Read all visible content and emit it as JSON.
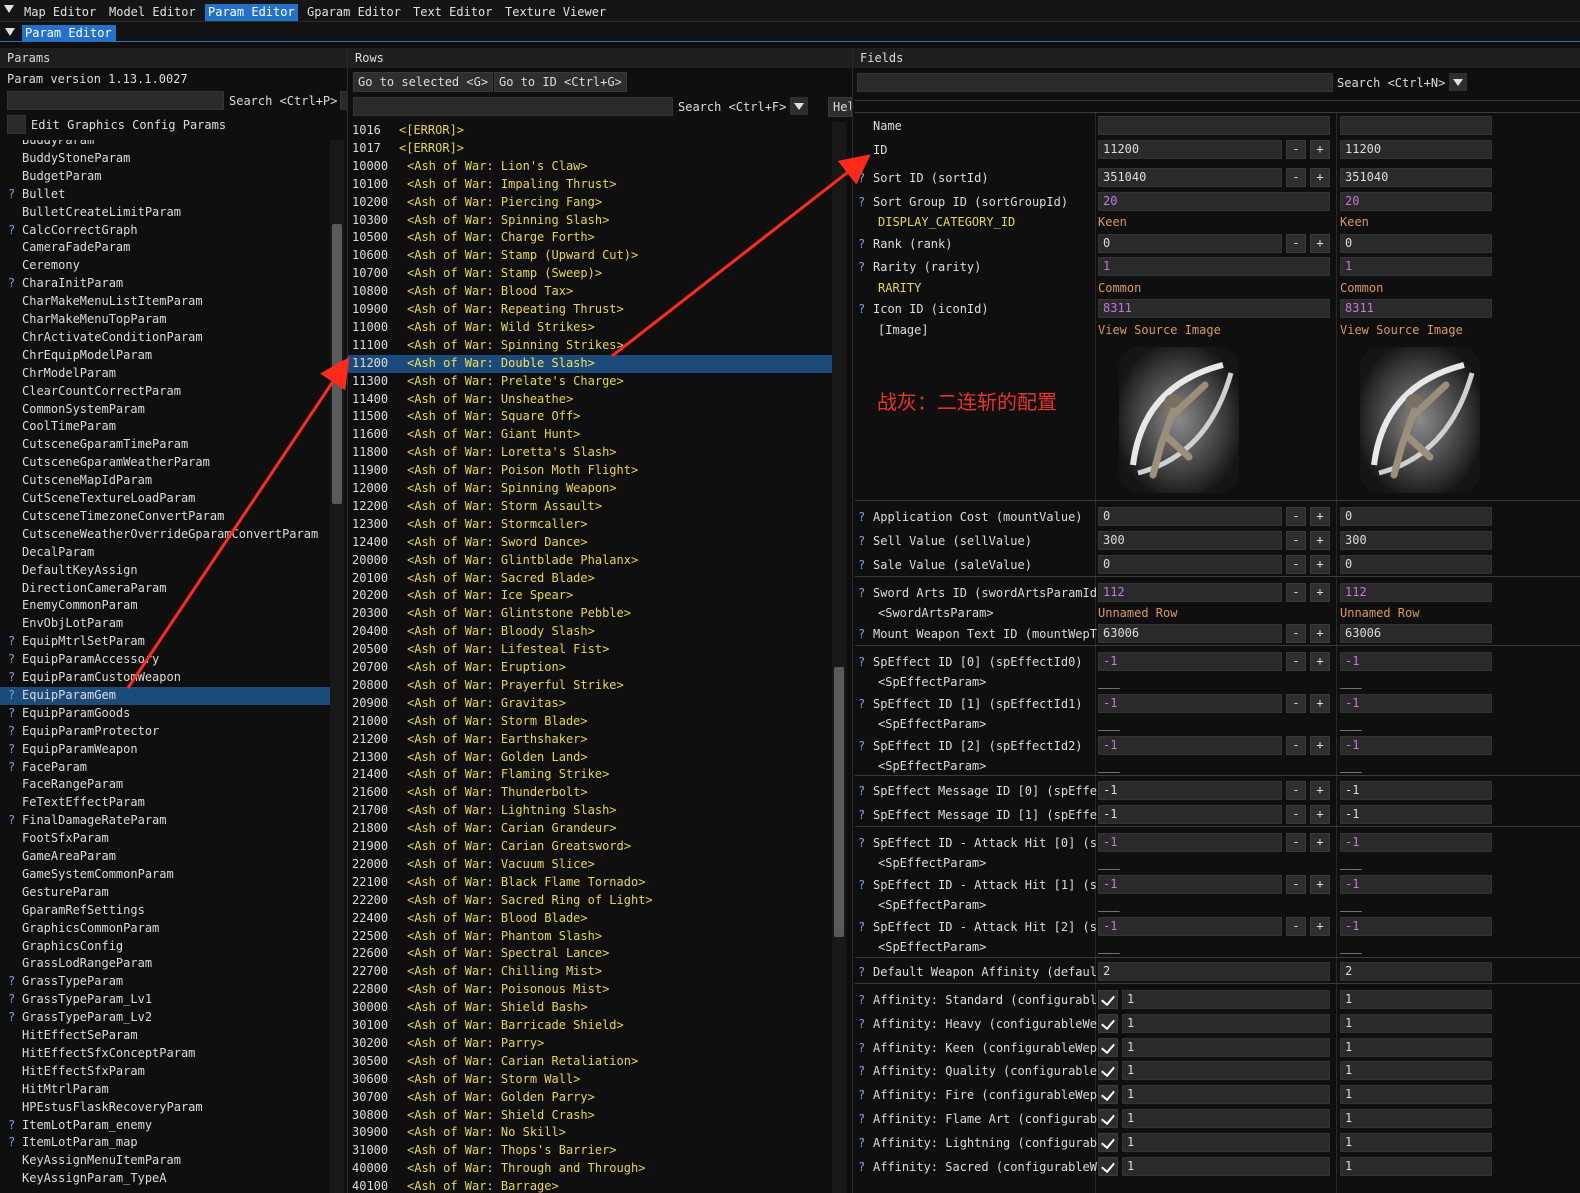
{
  "menu": {
    "items": [
      "Map Editor",
      "Model Editor",
      "Param Editor",
      "Gparam Editor",
      "Text Editor",
      "Texture Viewer"
    ],
    "active_index": 2
  },
  "subbar": {
    "tab": "Param Editor"
  },
  "params_panel": {
    "header": "Params",
    "version": "Param version 1.13.1.0027",
    "search_label": "Search <Ctrl+P>",
    "graphics_checkbox_label": "Edit Graphics Config Params",
    "items": [
      {
        "q": false,
        "name": "BuddyParam"
      },
      {
        "q": false,
        "name": "BuddyStoneParam"
      },
      {
        "q": false,
        "name": "BudgetParam"
      },
      {
        "q": true,
        "name": "Bullet"
      },
      {
        "q": false,
        "name": "BulletCreateLimitParam"
      },
      {
        "q": true,
        "name": "CalcCorrectGraph"
      },
      {
        "q": false,
        "name": "CameraFadeParam"
      },
      {
        "q": false,
        "name": "Ceremony"
      },
      {
        "q": true,
        "name": "CharaInitParam"
      },
      {
        "q": false,
        "name": "CharMakeMenuListItemParam"
      },
      {
        "q": false,
        "name": "CharMakeMenuTopParam"
      },
      {
        "q": false,
        "name": "ChrActivateConditionParam"
      },
      {
        "q": false,
        "name": "ChrEquipModelParam"
      },
      {
        "q": false,
        "name": "ChrModelParam"
      },
      {
        "q": false,
        "name": "ClearCountCorrectParam"
      },
      {
        "q": false,
        "name": "CommonSystemParam"
      },
      {
        "q": false,
        "name": "CoolTimeParam"
      },
      {
        "q": false,
        "name": "CutsceneGparamTimeParam"
      },
      {
        "q": false,
        "name": "CutsceneGparamWeatherParam"
      },
      {
        "q": false,
        "name": "CutsceneMapIdParam"
      },
      {
        "q": false,
        "name": "CutSceneTextureLoadParam"
      },
      {
        "q": false,
        "name": "CutsceneTimezoneConvertParam"
      },
      {
        "q": false,
        "name": "CutsceneWeatherOverrideGparamConvertParam"
      },
      {
        "q": false,
        "name": "DecalParam"
      },
      {
        "q": false,
        "name": "DefaultKeyAssign"
      },
      {
        "q": false,
        "name": "DirectionCameraParam"
      },
      {
        "q": false,
        "name": "EnemyCommonParam"
      },
      {
        "q": false,
        "name": "EnvObjLotParam"
      },
      {
        "q": true,
        "name": "EquipMtrlSetParam"
      },
      {
        "q": true,
        "name": "EquipParamAccessory"
      },
      {
        "q": true,
        "name": "EquipParamCustomWeapon"
      },
      {
        "q": true,
        "name": "EquipParamGem",
        "sel": true
      },
      {
        "q": true,
        "name": "EquipParamGoods"
      },
      {
        "q": true,
        "name": "EquipParamProtector"
      },
      {
        "q": true,
        "name": "EquipParamWeapon"
      },
      {
        "q": true,
        "name": "FaceParam"
      },
      {
        "q": false,
        "name": "FaceRangeParam"
      },
      {
        "q": false,
        "name": "FeTextEffectParam"
      },
      {
        "q": true,
        "name": "FinalDamageRateParam"
      },
      {
        "q": false,
        "name": "FootSfxParam"
      },
      {
        "q": false,
        "name": "GameAreaParam"
      },
      {
        "q": false,
        "name": "GameSystemCommonParam"
      },
      {
        "q": false,
        "name": "GestureParam"
      },
      {
        "q": false,
        "name": "GparamRefSettings"
      },
      {
        "q": false,
        "name": "GraphicsCommonParam"
      },
      {
        "q": false,
        "name": "GraphicsConfig"
      },
      {
        "q": false,
        "name": "GrassLodRangeParam"
      },
      {
        "q": true,
        "name": "GrassTypeParam"
      },
      {
        "q": true,
        "name": "GrassTypeParam_Lv1"
      },
      {
        "q": true,
        "name": "GrassTypeParam_Lv2"
      },
      {
        "q": false,
        "name": "HitEffectSeParam"
      },
      {
        "q": false,
        "name": "HitEffectSfxConceptParam"
      },
      {
        "q": false,
        "name": "HitEffectSfxParam"
      },
      {
        "q": false,
        "name": "HitMtrlParam"
      },
      {
        "q": false,
        "name": "HPEstusFlaskRecoveryParam"
      },
      {
        "q": true,
        "name": "ItemLotParam_enemy"
      },
      {
        "q": true,
        "name": "ItemLotParam_map"
      },
      {
        "q": false,
        "name": "KeyAssignMenuItemParam"
      },
      {
        "q": false,
        "name": "KeyAssignParam_TypeA"
      }
    ]
  },
  "rows_panel": {
    "header": "Rows",
    "goto_selected": "Go to selected <G>",
    "goto_id": "Go to ID <Ctrl+G>",
    "search_label": "Search <Ctrl+F>",
    "help_label": "Hel",
    "rows": [
      {
        "id": "1016",
        "name": "<[ERROR]>"
      },
      {
        "id": "1017",
        "name": "<[ERROR]>"
      },
      {
        "id": "10000",
        "name": "<Ash of War: Lion's Claw>"
      },
      {
        "id": "10100",
        "name": "<Ash of War: Impaling Thrust>"
      },
      {
        "id": "10200",
        "name": "<Ash of War: Piercing Fang>"
      },
      {
        "id": "10300",
        "name": "<Ash of War: Spinning Slash>"
      },
      {
        "id": "10500",
        "name": "<Ash of War: Charge Forth>"
      },
      {
        "id": "10600",
        "name": "<Ash of War: Stamp (Upward Cut)>"
      },
      {
        "id": "10700",
        "name": "<Ash of War: Stamp (Sweep)>"
      },
      {
        "id": "10800",
        "name": "<Ash of War: Blood Tax>"
      },
      {
        "id": "10900",
        "name": "<Ash of War: Repeating Thrust>"
      },
      {
        "id": "11000",
        "name": "<Ash of War: Wild Strikes>"
      },
      {
        "id": "11100",
        "name": "<Ash of War: Spinning Strikes>"
      },
      {
        "id": "11200",
        "name": "<Ash of War: Double Slash>",
        "sel": true
      },
      {
        "id": "11300",
        "name": "<Ash of War: Prelate's Charge>"
      },
      {
        "id": "11400",
        "name": "<Ash of War: Unsheathe>"
      },
      {
        "id": "11500",
        "name": "<Ash of War: Square Off>"
      },
      {
        "id": "11600",
        "name": "<Ash of War: Giant Hunt>"
      },
      {
        "id": "11800",
        "name": "<Ash of War: Loretta's Slash>"
      },
      {
        "id": "11900",
        "name": "<Ash of War: Poison Moth Flight>"
      },
      {
        "id": "12000",
        "name": "<Ash of War: Spinning Weapon>"
      },
      {
        "id": "12200",
        "name": "<Ash of War: Storm Assault>"
      },
      {
        "id": "12300",
        "name": "<Ash of War: Stormcaller>"
      },
      {
        "id": "12400",
        "name": "<Ash of War: Sword Dance>"
      },
      {
        "id": "20000",
        "name": "<Ash of War: Glintblade Phalanx>"
      },
      {
        "id": "20100",
        "name": "<Ash of War: Sacred Blade>"
      },
      {
        "id": "20200",
        "name": "<Ash of War: Ice Spear>"
      },
      {
        "id": "20300",
        "name": "<Ash of War: Glintstone Pebble>"
      },
      {
        "id": "20400",
        "name": "<Ash of War: Bloody Slash>"
      },
      {
        "id": "20500",
        "name": "<Ash of War: Lifesteal Fist>"
      },
      {
        "id": "20700",
        "name": "<Ash of War: Eruption>"
      },
      {
        "id": "20800",
        "name": "<Ash of War: Prayerful Strike>"
      },
      {
        "id": "20900",
        "name": "<Ash of War: Gravitas>"
      },
      {
        "id": "21000",
        "name": "<Ash of War: Storm Blade>"
      },
      {
        "id": "21200",
        "name": "<Ash of War: Earthshaker>"
      },
      {
        "id": "21300",
        "name": "<Ash of War: Golden Land>"
      },
      {
        "id": "21400",
        "name": "<Ash of War: Flaming Strike>"
      },
      {
        "id": "21600",
        "name": "<Ash of War: Thunderbolt>"
      },
      {
        "id": "21700",
        "name": "<Ash of War: Lightning Slash>"
      },
      {
        "id": "21800",
        "name": "<Ash of War: Carian Grandeur>"
      },
      {
        "id": "21900",
        "name": "<Ash of War: Carian Greatsword>"
      },
      {
        "id": "22000",
        "name": "<Ash of War: Vacuum Slice>"
      },
      {
        "id": "22100",
        "name": "<Ash of War: Black Flame Tornado>"
      },
      {
        "id": "22200",
        "name": "<Ash of War: Sacred Ring of Light>"
      },
      {
        "id": "22400",
        "name": "<Ash of War: Blood Blade>"
      },
      {
        "id": "22500",
        "name": "<Ash of War: Phantom Slash>"
      },
      {
        "id": "22600",
        "name": "<Ash of War: Spectral Lance>"
      },
      {
        "id": "22700",
        "name": "<Ash of War: Chilling Mist>"
      },
      {
        "id": "22800",
        "name": "<Ash of War: Poisonous Mist>"
      },
      {
        "id": "30000",
        "name": "<Ash of War: Shield Bash>"
      },
      {
        "id": "30100",
        "name": "<Ash of War: Barricade Shield>"
      },
      {
        "id": "30200",
        "name": "<Ash of War: Parry>"
      },
      {
        "id": "30500",
        "name": "<Ash of War: Carian Retaliation>"
      },
      {
        "id": "30600",
        "name": "<Ash of War: Storm Wall>"
      },
      {
        "id": "30700",
        "name": "<Ash of War: Golden Parry>"
      },
      {
        "id": "30800",
        "name": "<Ash of War: Shield Crash>"
      },
      {
        "id": "30900",
        "name": "<Ash of War: No Skill>"
      },
      {
        "id": "31000",
        "name": "<Ash of War: Thops's Barrier>"
      },
      {
        "id": "40000",
        "name": "<Ash of War: Through and Through>"
      },
      {
        "id": "40100",
        "name": "<Ash of War: Barrage>"
      }
    ]
  },
  "fields_panel": {
    "header": "Fields",
    "search_label": "Search <Ctrl+N>",
    "annotation": "战灰：二连斩的配置",
    "name_label": "Name",
    "id_label": "ID",
    "id_value": "11200",
    "sort_id_label": "Sort ID (sortId)",
    "sort_id_value": "351040",
    "sort_group_label": "Sort Group ID (sortGroupId)",
    "sort_group_value": "20",
    "display_category_label": "DISPLAY_CATEGORY_ID",
    "display_category_value": "Keen",
    "rank_label": "Rank (rank)",
    "rank_value": "0",
    "rarity_label": "Rarity (rarity)",
    "rarity_value": "1",
    "rarity_sub_label": "RARITY",
    "rarity_sub_value": "Common",
    "icon_label": "Icon ID (iconId)",
    "icon_value": "8311",
    "image_label": "[Image]",
    "view_source": "View Source Image",
    "app_cost_label": "Application Cost (mountValue)",
    "app_cost_value": "0",
    "sell_label": "Sell Value (sellValue)",
    "sell_value": "300",
    "sale_label": "Sale Value (saleValue)",
    "sale_value": "0",
    "sword_arts_label": "Sword Arts ID (swordArtsParamId",
    "sword_arts_value": "112",
    "sword_arts_ref": "<SwordArtsParam>",
    "sword_arts_ref_value": "Unnamed Row",
    "mount_text_label": "Mount Weapon Text ID (mountWepT",
    "mount_text_value": "63006",
    "sp0_label": "SpEffect ID [0] (spEffectId0)",
    "sp1_label": "SpEffect ID [1] (spEffectId1)",
    "sp2_label": "SpEffect ID [2] (spEffectId2)",
    "sp_ref": "<SpEffectParam>",
    "sp_ref_value": "___",
    "neg_one": "-1",
    "spmsg0_label": "SpEffect Message ID [0] (spEffe",
    "spmsg1_label": "SpEffect Message ID [1] (spEffe",
    "sphit0_label": "SpEffect ID - Attack Hit [0] (s",
    "sphit1_label": "SpEffect ID - Attack Hit [1] (s",
    "sphit2_label": "SpEffect ID - Attack Hit [2] (s",
    "default_aff_label": "Default Weapon Affinity (defaul",
    "default_aff_value": "2",
    "affinities": [
      {
        "label": "Affinity: Standard (configurabl",
        "value": "1"
      },
      {
        "label": "Affinity: Heavy (configurableWe",
        "value": "1"
      },
      {
        "label": "Affinity: Keen (configurableWep",
        "value": "1"
      },
      {
        "label": "Affinity: Quality (configurable",
        "value": "1"
      },
      {
        "label": "Affinity: Fire (configurableWep",
        "value": "1"
      },
      {
        "label": "Affinity: Flame Art (configurab",
        "value": "1"
      },
      {
        "label": "Affinity: Lightning (configurab",
        "value": "1"
      },
      {
        "label": "Affinity: Sacred (configurableW",
        "value": "1"
      }
    ],
    "minus": "-",
    "plus": "+",
    "q": "?"
  },
  "colors": {
    "accent": "#2472c8",
    "selected_row": "#1c4a7a",
    "row_name": "#e6d84a",
    "enum_value": "#d89a5a",
    "purple_value": "#c478d8",
    "annotation_red": "#e8322a",
    "arrow_red": "#ff2a1a"
  }
}
